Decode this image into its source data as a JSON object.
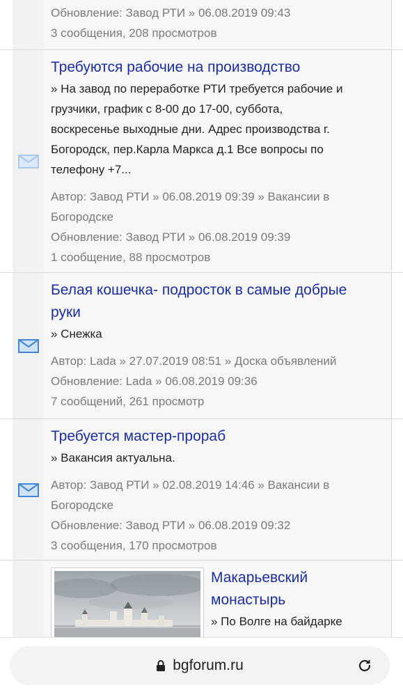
{
  "topics": [
    {
      "title": "",
      "excerpt": [],
      "meta": [
        "Обновление: Завод РТИ » 06.08.2019 09:43",
        "3 сообщения, 208 просмотров"
      ],
      "icon": "envelope-icon-read"
    },
    {
      "title": "Требуются рабочие на производство",
      "excerpt": [
        "» На завод по переработке РТИ требуется рабочие и",
        "грузчики, график с 8-00 до 17-00, суббота,",
        "воскресенье выходные дни. Адрес производства г.",
        "Богородск, пер.Карла Маркса д.1 Все вопросы по",
        "телефону +7..."
      ],
      "meta": [
        "Автор: Завод РТИ » 06.08.2019 09:39 » Вакансии в",
        "Богородске",
        "Обновление: Завод РТИ » 06.08.2019 09:39",
        "1 сообщение, 88 просмотров"
      ],
      "icon": "envelope-icon-read"
    },
    {
      "title_lines": [
        "Белая кошечка- подросток в самые добрые",
        "руки"
      ],
      "excerpt": [
        "» Снежка"
      ],
      "meta": [
        "Автор: Lada » 27.07.2019 08:51 » Доска объявлений",
        "Обновление: Lada » 06.08.2019 09:36",
        "7 сообщений, 261 просмотр"
      ],
      "icon": "envelope-icon-unread"
    },
    {
      "title": "Требуется мастер-прораб",
      "excerpt": [
        "» Вакансия актуальна."
      ],
      "meta": [
        "Автор: Завод РТИ » 02.08.2019 14:46 » Вакансии в",
        "Богородске",
        "Обновление: Завод РТИ » 06.08.2019 09:32",
        "3 сообщения, 170 просмотров"
      ],
      "icon": "envelope-icon-unread"
    },
    {
      "title_lines": [
        "Макарьевский",
        "монастырь"
      ],
      "excerpt": [
        "» По Волге на байдарке"
      ],
      "icon": "monastery-thumbnail"
    }
  ],
  "browser": {
    "url": "bgforum.ru"
  },
  "colors": {
    "link": "#1a2ea0",
    "meta": "#7a7a7a",
    "envelope_read": "#aac8ea",
    "envelope_unread": "#3f86d6"
  }
}
